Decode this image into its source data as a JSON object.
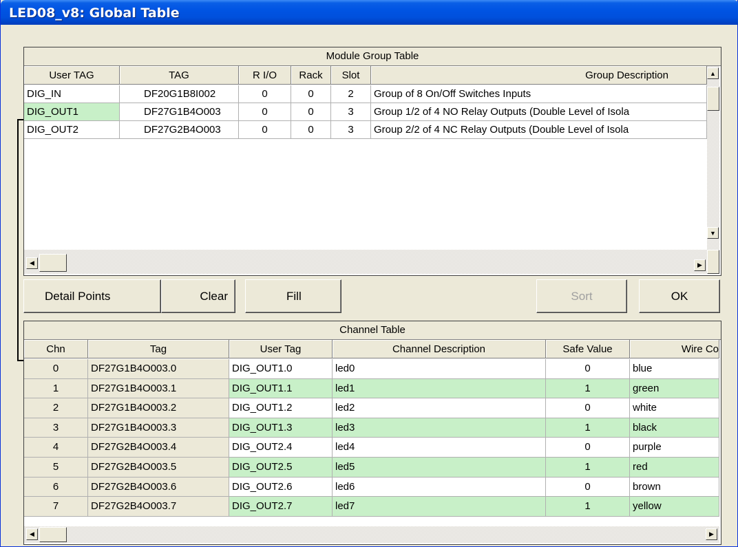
{
  "window": {
    "title": "LED08_v8: Global Table"
  },
  "module_table": {
    "caption": "Module Group Table",
    "columns": [
      "User TAG",
      "TAG",
      "R I/O",
      "Rack",
      "Slot",
      "Group Description"
    ],
    "rows": [
      {
        "user_tag": "DIG_IN",
        "tag": "DF20G1B8I002",
        "rio": "0",
        "rack": "0",
        "slot": "2",
        "description": "Group of 8 On/Off Switches Inputs"
      },
      {
        "user_tag": "DIG_OUT1",
        "tag": "DF27G1B4O003",
        "rio": "0",
        "rack": "0",
        "slot": "3",
        "description": "Group 1/2 of 4 NO Relay Outputs (Double Level of Isola"
      },
      {
        "user_tag": "DIG_OUT2",
        "tag": "DF27G2B4O003",
        "rio": "0",
        "rack": "0",
        "slot": "3",
        "description": "Group 2/2 of 4 NC Relay Outputs (Double Level of Isola"
      }
    ],
    "highlight_color": "#c8f0c8"
  },
  "buttons": {
    "detail_points": "Detail Points",
    "clear": "Clear",
    "fill": "Fill",
    "sort": "Sort",
    "ok": "OK"
  },
  "channel_table": {
    "caption": "Channel Table",
    "columns": [
      "Chn",
      "Tag",
      "User Tag",
      "Channel Description",
      "Safe Value",
      "Wire Co"
    ],
    "rows": [
      {
        "chn": "0",
        "tag": "DF27G1B4O003.0",
        "user_tag": "DIG_OUT1.0",
        "description": "led0",
        "safe": "0",
        "wire": "blue"
      },
      {
        "chn": "1",
        "tag": "DF27G1B4O003.1",
        "user_tag": "DIG_OUT1.1",
        "description": "led1",
        "safe": "1",
        "wire": "green"
      },
      {
        "chn": "2",
        "tag": "DF27G1B4O003.2",
        "user_tag": "DIG_OUT1.2",
        "description": "led2",
        "safe": "0",
        "wire": "white"
      },
      {
        "chn": "3",
        "tag": "DF27G1B4O003.3",
        "user_tag": "DIG_OUT1.3",
        "description": "led3",
        "safe": "1",
        "wire": "black"
      },
      {
        "chn": "4",
        "tag": "DF27G2B4O003.4",
        "user_tag": "DIG_OUT2.4",
        "description": "led4",
        "safe": "0",
        "wire": "purple"
      },
      {
        "chn": "5",
        "tag": "DF27G2B4O003.5",
        "user_tag": "DIG_OUT2.5",
        "description": "led5",
        "safe": "1",
        "wire": "red"
      },
      {
        "chn": "6",
        "tag": "DF27G2B4O003.6",
        "user_tag": "DIG_OUT2.6",
        "description": "led6",
        "safe": "0",
        "wire": "brown"
      },
      {
        "chn": "7",
        "tag": "DF27G2B4O003.7",
        "user_tag": "DIG_OUT2.7",
        "description": "led7",
        "safe": "1",
        "wire": "yellow"
      }
    ]
  },
  "icons": {
    "scroll_up": "scroll-up-arrow-icon",
    "scroll_down": "scroll-down-arrow-icon",
    "scroll_left": "scroll-left-arrow-icon",
    "scroll_right": "scroll-right-arrow-icon"
  }
}
